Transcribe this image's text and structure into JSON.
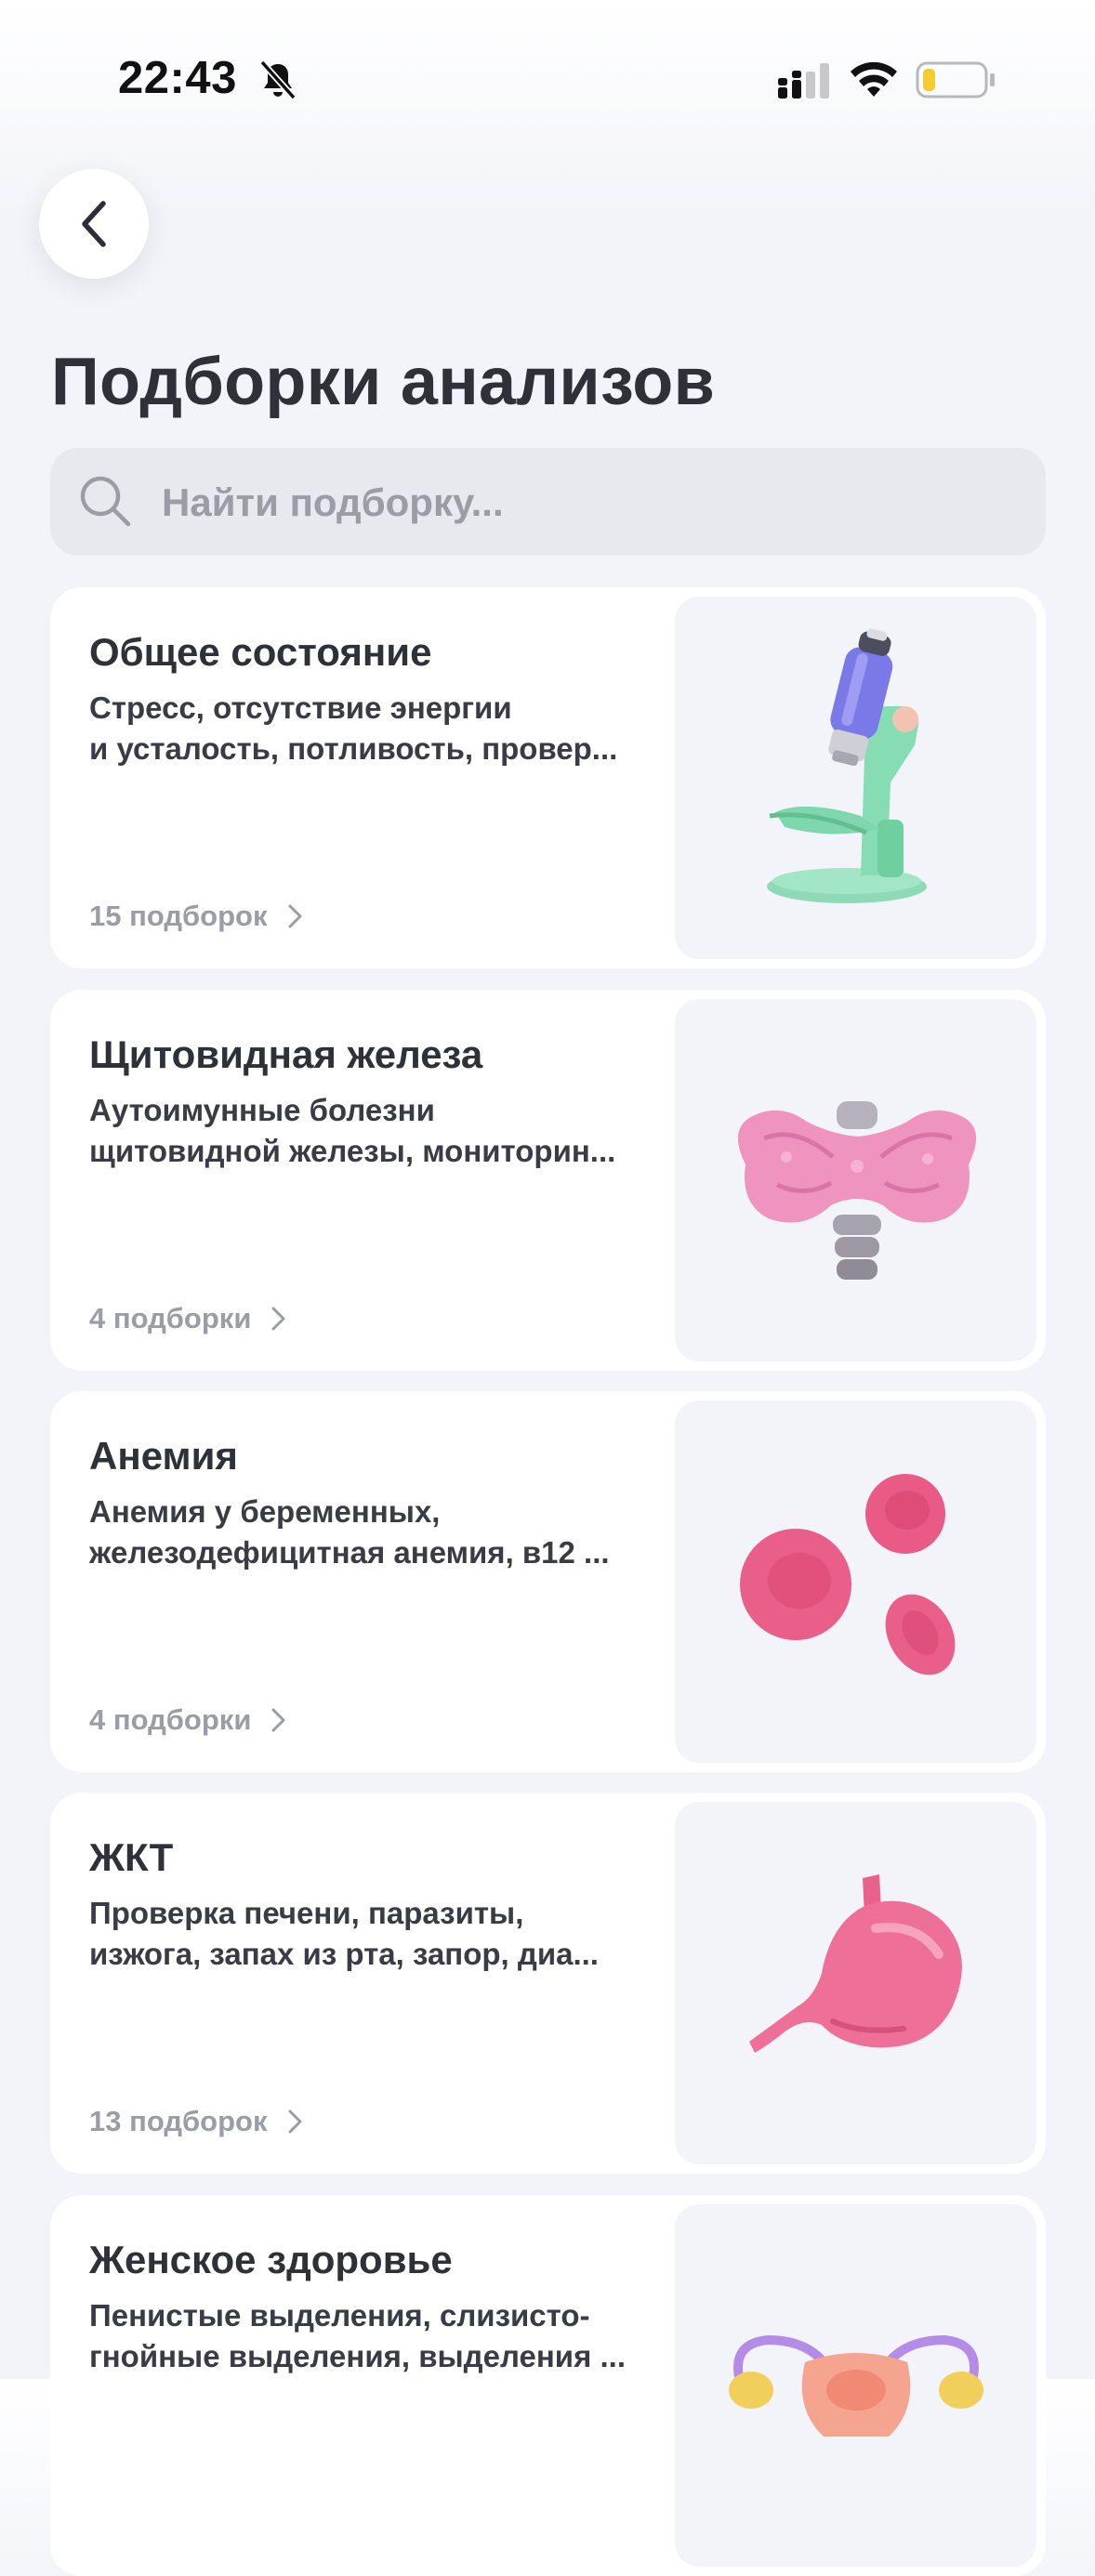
{
  "status_bar": {
    "time": "22:43",
    "icons": [
      "bell-slash-icon",
      "cellular-signal-icon",
      "wifi-icon",
      "battery-low-icon"
    ],
    "battery_level": 0.2
  },
  "header": {
    "back_icon": "chevron-left-icon",
    "title": "Подборки анализов"
  },
  "search": {
    "placeholder": "Найти подборку...",
    "value": "",
    "icon": "search-icon"
  },
  "colors": {
    "background": "#f3f4f9",
    "card": "#ffffff",
    "text_primary": "#2f3038",
    "text_muted": "#9a9ca6",
    "search_bg": "#e8e9ef",
    "accent_pink": "#e8628d"
  },
  "collections": [
    {
      "title": "Общее состояние",
      "desc_line1": "Стресс, отсутствие энергии",
      "desc_line2": "и усталость, потливость, провер...",
      "count": "15 подборок",
      "image": "microscope-icon"
    },
    {
      "title": "Щитовидная железа",
      "desc_line1": "Аутоимунные болезни",
      "desc_line2": "щитовидной железы, мониторин...",
      "count": "4 подборки",
      "image": "thyroid-icon"
    },
    {
      "title": "Анемия",
      "desc_line1": "Анемия у беременных,",
      "desc_line2": "железодефицитная анемия, в12 ...",
      "count": "4 подборки",
      "image": "red-blood-cells-icon"
    },
    {
      "title": "ЖКТ",
      "desc_line1": "Проверка печени, паразиты,",
      "desc_line2": "изжога, запах из рта, запор, диа...",
      "count": "13 подборок",
      "image": "stomach-icon"
    },
    {
      "title": "Женское здоровье",
      "desc_line1": "Пенистые выделения, слизисто-",
      "desc_line2": "гнойные выделения, выделения ...",
      "count": "",
      "image": "uterus-icon"
    }
  ]
}
